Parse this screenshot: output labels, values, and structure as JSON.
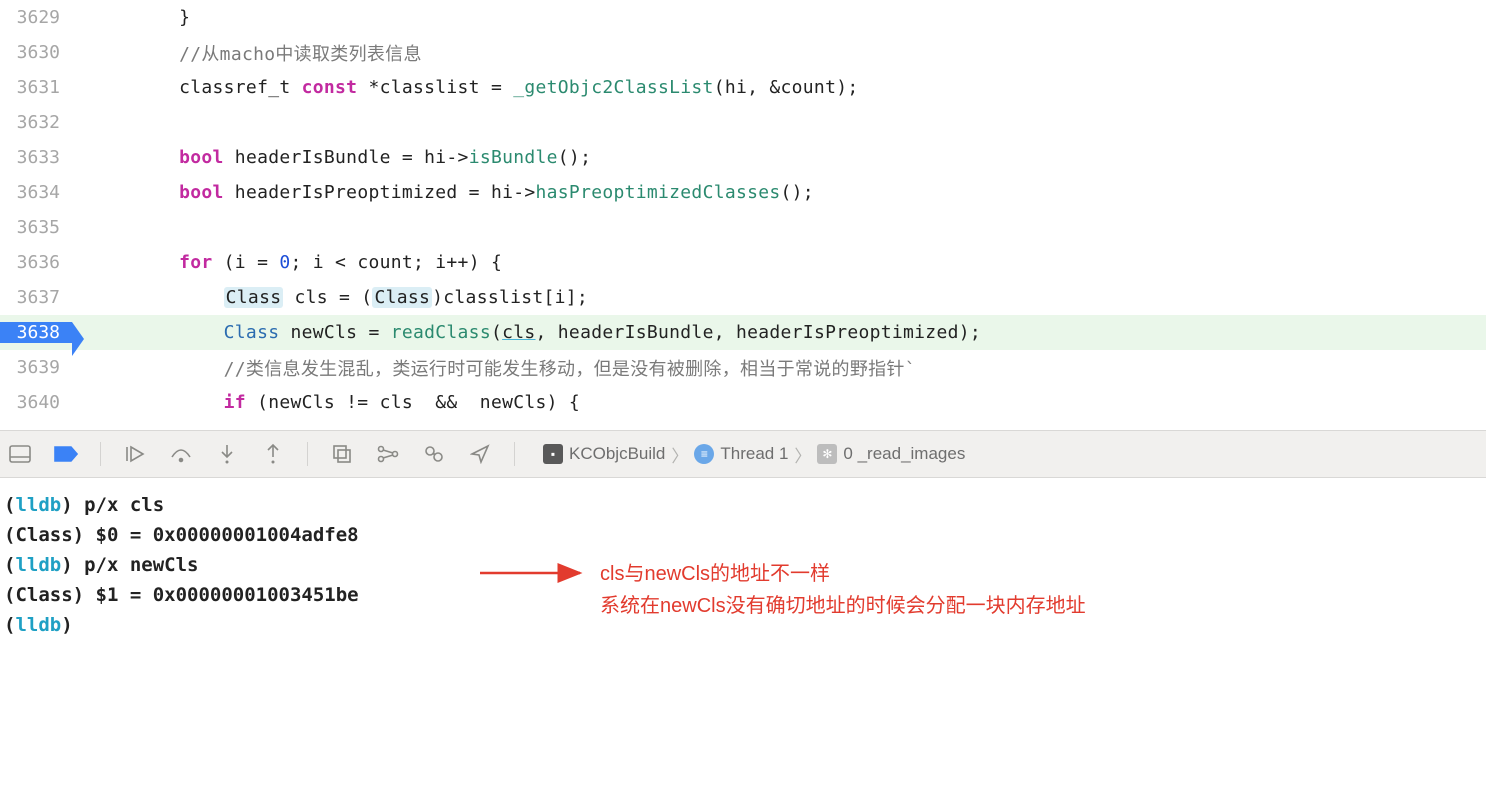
{
  "editor": {
    "lines": [
      {
        "num": 3629,
        "indent": 8,
        "tokens": [
          {
            "t": "}",
            "c": ""
          }
        ]
      },
      {
        "num": 3630,
        "indent": 8,
        "tokens": [
          {
            "t": "//从macho中读取类列表信息",
            "c": "cmt"
          }
        ]
      },
      {
        "num": 3631,
        "indent": 8,
        "tokens": [
          {
            "t": "classref_t ",
            "c": ""
          },
          {
            "t": "const",
            "c": "kw"
          },
          {
            "t": " *classlist = ",
            "c": ""
          },
          {
            "t": "_getObjc2ClassList",
            "c": "fn"
          },
          {
            "t": "(hi, &count);",
            "c": ""
          }
        ]
      },
      {
        "num": 3632,
        "indent": 8,
        "tokens": []
      },
      {
        "num": 3633,
        "indent": 8,
        "tokens": [
          {
            "t": "bool",
            "c": "kw"
          },
          {
            "t": " headerIsBundle = hi->",
            "c": ""
          },
          {
            "t": "isBundle",
            "c": "fn"
          },
          {
            "t": "();",
            "c": ""
          }
        ]
      },
      {
        "num": 3634,
        "indent": 8,
        "tokens": [
          {
            "t": "bool",
            "c": "kw"
          },
          {
            "t": " headerIsPreoptimized = hi->",
            "c": ""
          },
          {
            "t": "hasPreoptimizedClasses",
            "c": "fn"
          },
          {
            "t": "();",
            "c": ""
          }
        ]
      },
      {
        "num": 3635,
        "indent": 8,
        "tokens": []
      },
      {
        "num": 3636,
        "indent": 8,
        "tokens": [
          {
            "t": "for",
            "c": "kw"
          },
          {
            "t": " (i = ",
            "c": ""
          },
          {
            "t": "0",
            "c": "num"
          },
          {
            "t": "; i < count; i++) {",
            "c": ""
          }
        ]
      },
      {
        "num": 3637,
        "indent": 12,
        "tokens": [
          {
            "t": "Class",
            "c": "hlbox"
          },
          {
            "t": " cls = (",
            "c": ""
          },
          {
            "t": "Class",
            "c": "hlbox"
          },
          {
            "t": ")classlist[i];",
            "c": ""
          }
        ]
      },
      {
        "num": 3638,
        "indent": 12,
        "hl": true,
        "bp": true,
        "tokens": [
          {
            "t": "Class",
            "c": "type"
          },
          {
            "t": " newCls = ",
            "c": ""
          },
          {
            "t": "readClass",
            "c": "fn"
          },
          {
            "t": "(",
            "c": ""
          },
          {
            "t": "cls",
            "c": "ul"
          },
          {
            "t": ", headerIsBundle, headerIsPreoptimized);",
            "c": ""
          }
        ]
      },
      {
        "num": 3639,
        "indent": 12,
        "tokens": [
          {
            "t": "//类信息发生混乱，类运行时可能发生移动，但是没有被删除，相当于常说的野指针`",
            "c": "cmt"
          }
        ]
      },
      {
        "num": 3640,
        "indent": 12,
        "tokens": [
          {
            "t": "if",
            "c": "kw"
          },
          {
            "t": " (newCls != cls  &&  newCls) {",
            "c": ""
          }
        ]
      }
    ]
  },
  "toolbar": {
    "crumbs": {
      "target": "KCObjcBuild",
      "thread": "Thread 1",
      "frame": "0 _read_images"
    }
  },
  "console": {
    "rows": [
      {
        "seg": [
          {
            "t": "(",
            "c": ""
          },
          {
            "t": "lldb",
            "c": "lldb"
          },
          {
            "t": ") ",
            "c": ""
          },
          {
            "t": "p/x cls",
            "c": "bold"
          }
        ]
      },
      {
        "seg": [
          {
            "t": "(Class) $0 = 0x00000001004adfe8",
            "c": ""
          }
        ]
      },
      {
        "seg": [
          {
            "t": "(",
            "c": ""
          },
          {
            "t": "lldb",
            "c": "lldb"
          },
          {
            "t": ") ",
            "c": ""
          },
          {
            "t": "p/x newCls",
            "c": "bold"
          }
        ]
      },
      {
        "seg": [
          {
            "t": "(Class) $1 = 0x00000001003451be",
            "c": ""
          }
        ]
      },
      {
        "seg": [
          {
            "t": "(",
            "c": ""
          },
          {
            "t": "lldb",
            "c": "lldb"
          },
          {
            "t": ") ",
            "c": ""
          }
        ]
      }
    ],
    "annotation": {
      "l1": "cls与newCls的地址不一样",
      "l2": "系统在newCls没有确切地址的时候会分配一块内存地址"
    }
  }
}
